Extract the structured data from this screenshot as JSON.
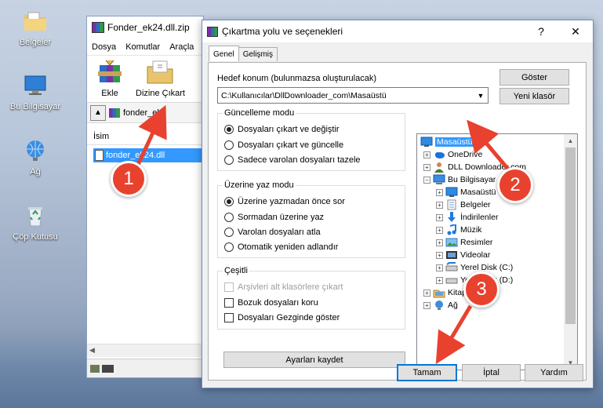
{
  "desktop": {
    "icons": [
      {
        "label": "Belgeler"
      },
      {
        "label": "Bu Bilgisayar"
      },
      {
        "label": "Ağ"
      },
      {
        "label": "Çöp Kutusu"
      }
    ]
  },
  "rar": {
    "title": "Fonder_ek24.dll.zip",
    "menu": [
      "Dosya",
      "Komutlar",
      "Araçla"
    ],
    "toolbar": {
      "add_label": "Ekle",
      "extract_label": "Dizine Çıkart"
    },
    "path_text": "fonder_ek2",
    "column_name": "İsim",
    "file_name": "fonder_ek24.dll"
  },
  "dialog": {
    "title": "Çıkartma yolu ve seçenekleri",
    "help_symbol": "?",
    "close_symbol": "✕",
    "tabs": [
      "Genel",
      "Gelişmiş"
    ],
    "dest_label": "Hedef konum (bulunmazsa oluşturulacak)",
    "dest_value": "C:\\Kullanıcılar\\DllDownloader_com\\Masaüstü",
    "show_button": "Göster",
    "new_folder_button": "Yeni klasör",
    "update_group": {
      "title": "Güncelleme modu",
      "options": [
        "Dosyaları çıkart ve değiştir",
        "Dosyaları çıkart ve güncelle",
        "Sadece varolan dosyaları tazele"
      ]
    },
    "overwrite_group": {
      "title": "Üzerine yaz modu",
      "options": [
        "Üzerine yazmadan önce sor",
        "Sormadan üzerine yaz",
        "Varolan dosyaları atla",
        "Otomatik yeniden adlandır"
      ]
    },
    "misc_group": {
      "title": "Çeşitli",
      "options": [
        "Arşivleri alt klasörlere çıkart",
        "Bozuk dosyaları koru",
        "Dosyaları Gezginde göster"
      ]
    },
    "save_settings_button": "Ayarları kaydet",
    "tree": [
      {
        "label": "Masaüstü",
        "icon": "desktop-icon"
      },
      {
        "label": "OneDrive",
        "icon": "cloud-icon"
      },
      {
        "label": "DLL Downloader.com",
        "icon": "user-icon"
      },
      {
        "label": "Bu Bilgisayar",
        "icon": "computer-icon"
      },
      {
        "label": "Masaüstü",
        "icon": "desktop-icon"
      },
      {
        "label": "Belgeler",
        "icon": "documents-icon"
      },
      {
        "label": "İndirilenler",
        "icon": "download-icon"
      },
      {
        "label": "Müzik",
        "icon": "music-icon"
      },
      {
        "label": "Resimler",
        "icon": "pictures-icon"
      },
      {
        "label": "Videolar",
        "icon": "video-icon"
      },
      {
        "label": "Yerel Disk (C:)",
        "icon": "disk-icon"
      },
      {
        "label": "Yerel Disk (D:)",
        "icon": "disk-icon"
      },
      {
        "label": "Kitaplıklar",
        "icon": "library-icon"
      },
      {
        "label": "Ağ",
        "icon": "network-icon"
      }
    ],
    "ok_button": "Tamam",
    "cancel_button": "İptal",
    "help_button": "Yardım"
  },
  "annotations": [
    "1",
    "2",
    "3"
  ],
  "colors": {
    "selection": "#3399ff",
    "badge": "#e8422f",
    "default_button_border": "#0078d7"
  }
}
